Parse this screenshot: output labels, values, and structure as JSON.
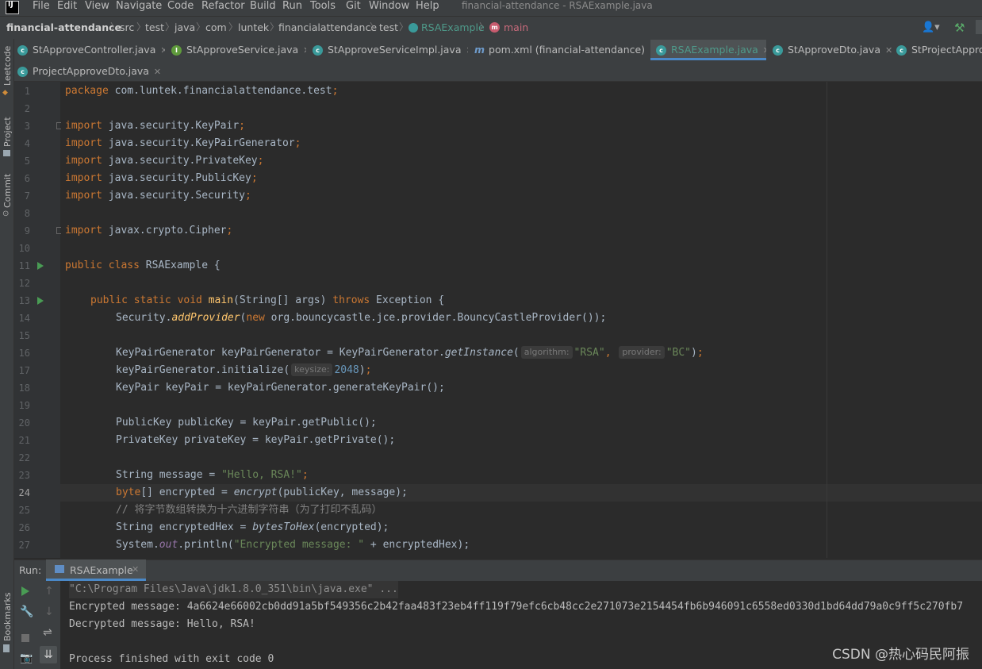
{
  "menubar": {
    "app_icon": "intellij-idea-icon",
    "items": [
      "File",
      "Edit",
      "View",
      "Navigate",
      "Code",
      "Refactor",
      "Build",
      "Run",
      "Tools",
      "Git",
      "Window",
      "Help"
    ],
    "window_title": "financial-attendance - RSAExample.java"
  },
  "breadcrumb": {
    "project": "financial-attendance",
    "path": [
      "src",
      "test",
      "java",
      "com",
      "luntek",
      "financialattendance",
      "test"
    ],
    "class": "RSAExample",
    "method": "main"
  },
  "tabs": [
    {
      "label": "StApproveControllerjava",
      "display": "StApproveController.java",
      "icon": "class-icon",
      "active": false
    },
    {
      "label": "StApproveService.java",
      "icon": "interface-icon",
      "active": false
    },
    {
      "label": "StApproveServiceImpl.java",
      "icon": "class-icon",
      "active": false
    },
    {
      "label": "pom.xml (financial-attendance)",
      "icon": "maven-icon",
      "active": false
    },
    {
      "label": "RSAExample.java",
      "icon": "class-icon",
      "active": true
    },
    {
      "label": "StApproveDto.java",
      "icon": "class-icon",
      "active": false
    },
    {
      "label": "StProjectApprov",
      "icon": "class-icon",
      "active": false
    },
    {
      "label": "ProjectApproveDto.java",
      "icon": "class-icon",
      "active": false
    }
  ],
  "left_tools": [
    "Leetcode",
    "Project",
    "Commit",
    "Bookmarks"
  ],
  "editor": {
    "current_line": 24,
    "line_numbers": [
      "1",
      "2",
      "3",
      "4",
      "5",
      "6",
      "7",
      "8",
      "9",
      "10",
      "11",
      "12",
      "13",
      "14",
      "15",
      "16",
      "17",
      "18",
      "19",
      "20",
      "21",
      "22",
      "23",
      "24",
      "25",
      "26",
      "27"
    ],
    "lines": {
      "l1_package": "package",
      "l1_name": " com.luntek.financialattendance.test",
      "l3": "java.security.KeyPair",
      "l4": "java.security.KeyPairGenerator",
      "l5": "java.security.PrivateKey",
      "l6": "java.security.PublicKey",
      "l7": "java.security.Security",
      "l9": "javax.crypto.Cipher",
      "import_kw": "import",
      "l11_kw": "public class",
      "l11_name": " RSAExample {",
      "l13_kw": "public static void",
      "l13_name": "main",
      "l13_params": "(String[] args) ",
      "l13_throws": "throws",
      "l13_rest": " Exception {",
      "l14_a": "Security.",
      "l14_method": "addProvider",
      "l14_b": "(",
      "l14_new": "new",
      "l14_c": " org.bouncycastle.jce.provider.BouncyCastleProvider());",
      "l16_a": "KeyPairGenerator keyPairGenerator = KeyPairGenerator.",
      "l16_method": "getInstance",
      "l16_hint1": "algorithm:",
      "l16_str1": "\"RSA\"",
      "l16_hint2": "provider:",
      "l16_str2": "\"BC\"",
      "l17_a": "keyPairGenerator.initialize(",
      "l17_hint": "keysize:",
      "l17_num": "2048",
      "l18": "KeyPair keyPair = keyPairGenerator.generateKeyPair();",
      "l20": "PublicKey publicKey = keyPair.getPublic();",
      "l21": "PrivateKey privateKey = keyPair.getPrivate();",
      "l23_a": "String message = ",
      "l23_str": "\"Hello, RSA!\"",
      "l24_kw": "byte",
      "l24_a": "[] encrypted = ",
      "l24_method": "encrypt",
      "l24_b": "(publicKey, message);",
      "l25": "// 将字节数组转换为十六进制字符串（为了打印不乱码）",
      "l26_a": "String encryptedHex = ",
      "l26_method": "bytesToHex",
      "l26_b": "(encrypted);",
      "l27_a": "System.",
      "l27_field": "out",
      "l27_b": ".println(",
      "l27_str": "\"Encrypted message: \"",
      "l27_c": " + encryptedHex);"
    }
  },
  "run_panel": {
    "label": "Run:",
    "tab": "RSAExample",
    "output": [
      "\"C:\\Program Files\\Java\\jdk1.8.0_351\\bin\\java.exe\" ...",
      "Encrypted message: 4a6624e66002cb0dd91a5bf549356c2b42faa483f23eb4ff119f79efc6cb48cc2e271073e2154454fb6b946091c6558ed0330d1bd64dd79a0c9ff5c270fb7",
      "Decrypted message: Hello, RSA!",
      "",
      "Process finished with exit code 0"
    ]
  },
  "watermark": "CSDN @热心码民阿振",
  "colors": {
    "keyword": "#cc7832",
    "string": "#6a8759",
    "number": "#6897bb",
    "method": "#ffc66d",
    "accent": "#4a88c7"
  }
}
